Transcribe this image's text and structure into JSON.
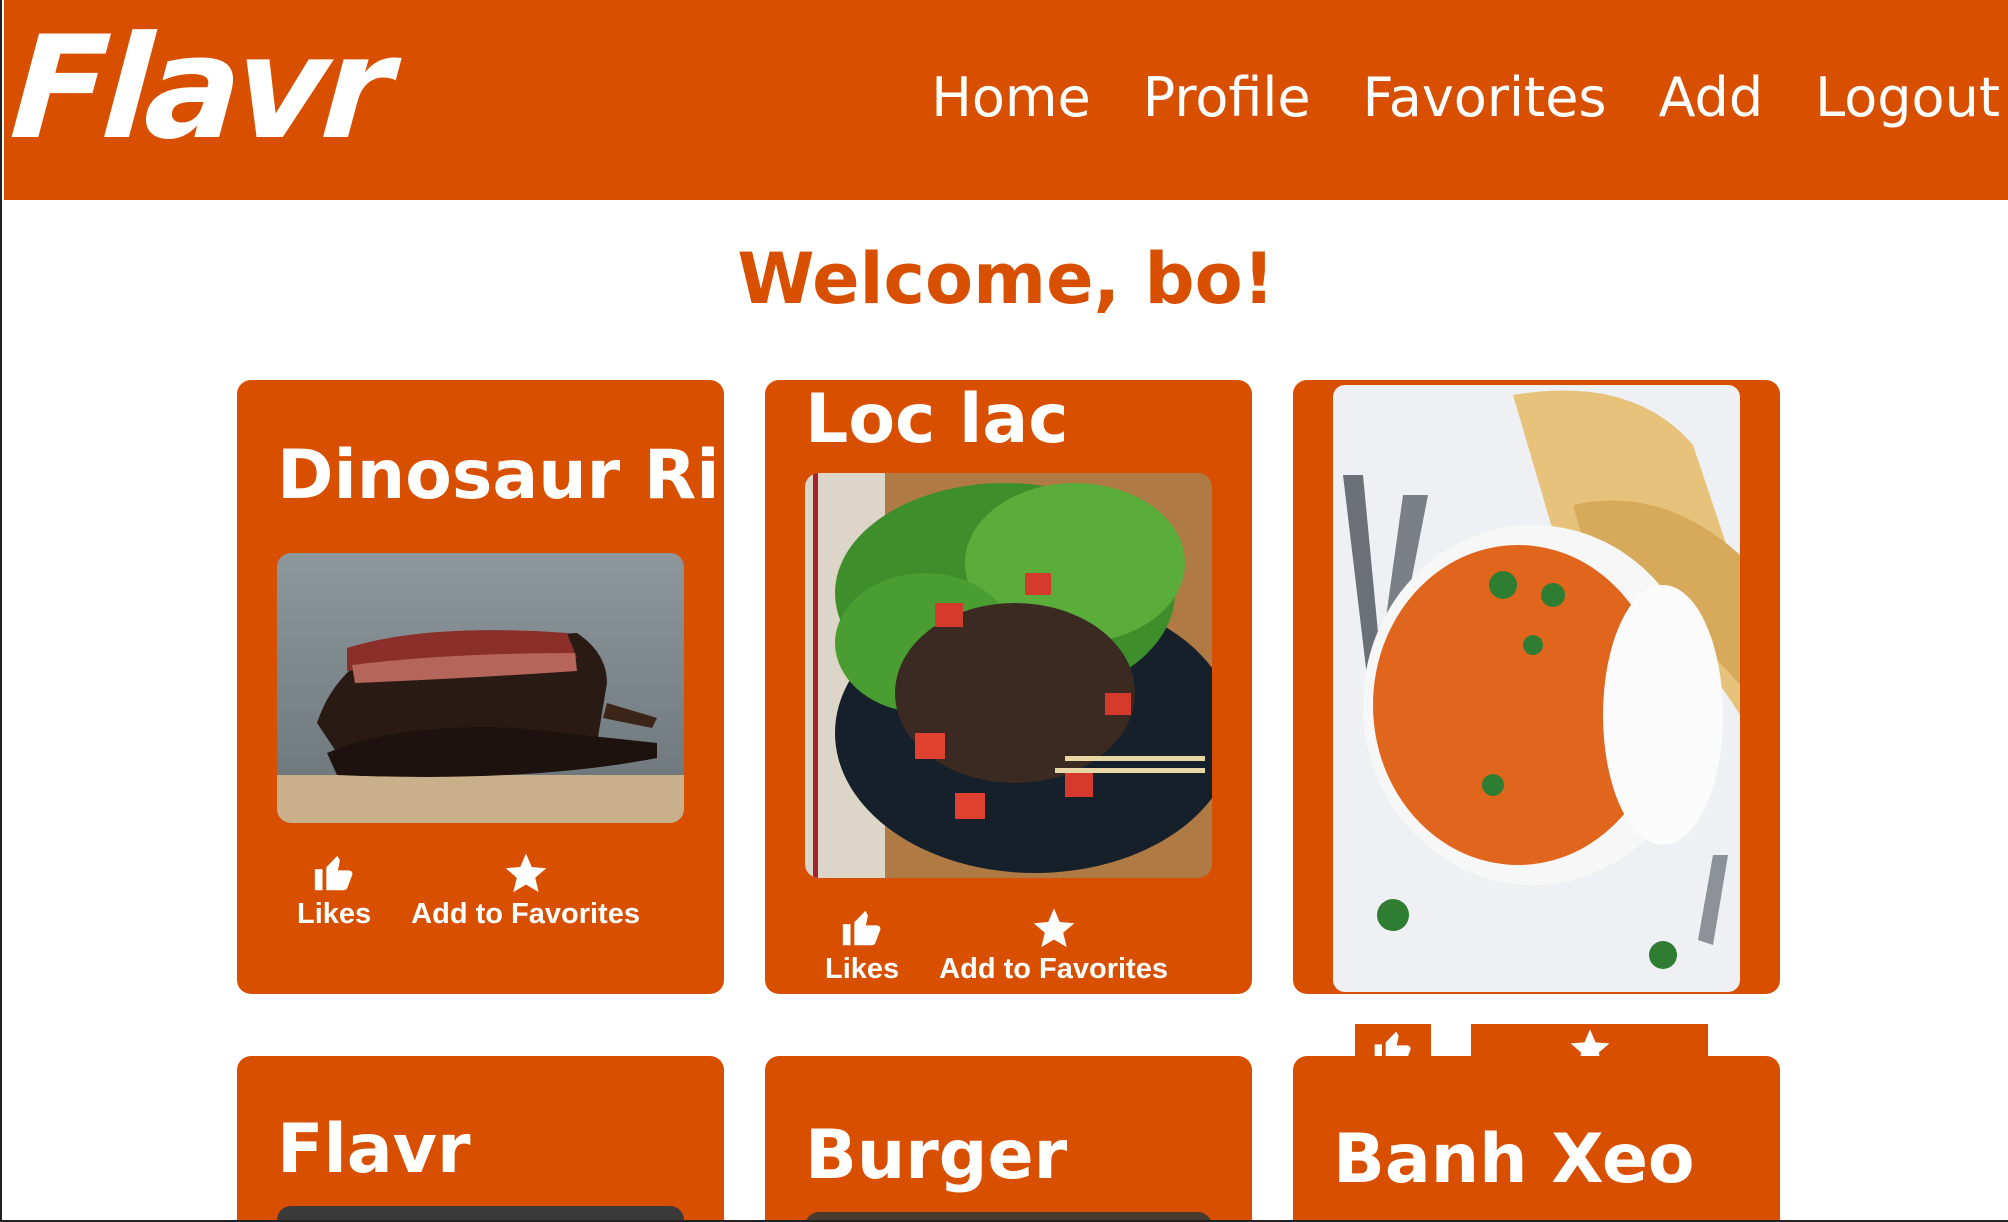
{
  "app": {
    "logo_text": "Flavr"
  },
  "nav": {
    "items": [
      "Home",
      "Profile",
      "Favorites",
      "Add",
      "Logout"
    ]
  },
  "welcome": "Welcome, bo!",
  "cards": [
    {
      "title": "Dinosaur Ribs",
      "image": "smoked beef ribs",
      "likes_label": "Likes",
      "fav_label": "Add to Favorites"
    },
    {
      "title": "Loc lac",
      "image": "shaking beef salad",
      "likes_label": "Likes",
      "fav_label": "Add to Favorites"
    },
    {
      "title": "",
      "image": "butter chicken curry with naan and rice"
    },
    {
      "title": "Flavr"
    },
    {
      "title": "Burger"
    },
    {
      "title": "Banh Xeo"
    }
  ],
  "colors": {
    "brand": "#d94f00",
    "text_on_brand": "#ffffff"
  },
  "icons": {
    "like": "thumbs-up-icon",
    "favorite": "star-icon"
  }
}
